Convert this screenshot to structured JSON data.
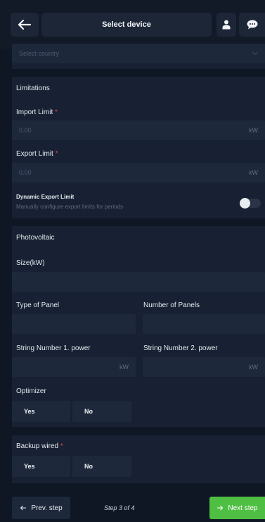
{
  "header": {
    "title": "Select device",
    "back_icon": "arrow-left-icon",
    "user_icon": "user-icon",
    "chat_icon": "chat-bubble-icon"
  },
  "country": {
    "placeholder": "Select country",
    "chevron_icon": "chevron-down-icon"
  },
  "limitations": {
    "title": "Limitations",
    "import_label": "Import Limit",
    "import_placeholder": "0.00",
    "import_unit": "kW",
    "export_label": "Export Limit",
    "export_placeholder": "0.00",
    "export_unit": "kW",
    "required_mark": "*",
    "dynamic_title": "Dynamic Export Limit",
    "dynamic_desc": "Manually configure export limits for periods"
  },
  "photovoltaic": {
    "title": "Photovoltaic",
    "size_label": "Size(kW)",
    "type_panel_label": "Type of Panel",
    "num_panels_label": "Number of Panels",
    "string1_label": "String Number 1. power",
    "string1_unit": "kW",
    "string2_label": "String Number 2. power",
    "string2_unit": "kW",
    "optimizer_label": "Optimizer",
    "yes": "Yes",
    "no": "No"
  },
  "backup": {
    "label": "Backup wired",
    "required_mark": "*",
    "yes": "Yes",
    "no": "No"
  },
  "footer": {
    "prev_label": "Prev. step",
    "step_text": "Step 3 of 4",
    "next_label": "Next step"
  },
  "colors": {
    "background": "#0f1624",
    "card": "#172133",
    "input": "#1d283b",
    "accent_green": "#4fbf43",
    "required_red": "#e0474c"
  }
}
